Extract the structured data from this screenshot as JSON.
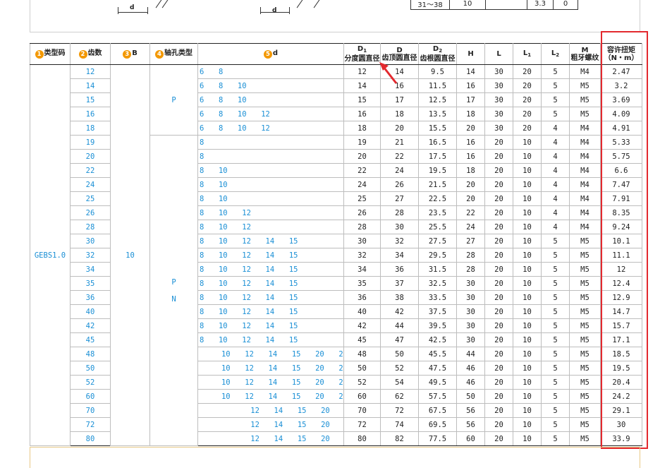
{
  "top_drawing": {
    "dim_label_1": "d",
    "dim_label_2": "d",
    "spec_row": [
      "31～38",
      "10",
      "",
      "3.3",
      "0"
    ]
  },
  "headers": {
    "type_code": {
      "num": "1",
      "label": "类型码"
    },
    "teeth": {
      "num": "2",
      "label": "齿数"
    },
    "b": {
      "num": "3",
      "label": "B"
    },
    "bore_type": {
      "num": "4",
      "label": "轴孔类型"
    },
    "d": {
      "num": "5",
      "label": "d"
    },
    "d1": {
      "sym": "D",
      "sub": "1",
      "text": "分度圆直径"
    },
    "dd": {
      "sym": "D",
      "text": "齿顶圆直径"
    },
    "d2": {
      "sym": "D",
      "sub": "2",
      "text": "齿根圆直径"
    },
    "h": "H",
    "l": "L",
    "l1": {
      "sym": "L",
      "sub": "1"
    },
    "l2": {
      "sym": "L",
      "sub": "2"
    },
    "m": {
      "sym": "M",
      "text": "粗牙螺纹"
    },
    "torque": {
      "line1": "容许扭矩",
      "line2": "（N・m）"
    }
  },
  "type_code": "GEBS1.0",
  "b_value": "10",
  "bore_p": "P",
  "bore_pn": {
    "p": "P",
    "n": "N"
  },
  "rows": [
    {
      "teeth": "12",
      "d": "6  8",
      "d1": "12",
      "dd": "14",
      "d2": "9.5",
      "h": "14",
      "l": "30",
      "l1": "20",
      "l2": "5",
      "m": "M4",
      "torque": "2.47"
    },
    {
      "teeth": "14",
      "d": "6  8  10",
      "d1": "14",
      "dd": "16",
      "d2": "11.5",
      "h": "16",
      "l": "30",
      "l1": "20",
      "l2": "5",
      "m": "M5",
      "torque": "3.2"
    },
    {
      "teeth": "15",
      "d": "6  8  10",
      "d1": "15",
      "dd": "17",
      "d2": "12.5",
      "h": "17",
      "l": "30",
      "l1": "20",
      "l2": "5",
      "m": "M5",
      "torque": "3.69"
    },
    {
      "teeth": "16",
      "d": "6  8  10  12",
      "d1": "16",
      "dd": "18",
      "d2": "13.5",
      "h": "18",
      "l": "30",
      "l1": "20",
      "l2": "5",
      "m": "M5",
      "torque": "4.09"
    },
    {
      "teeth": "18",
      "d": "6  8  10  12",
      "d1": "18",
      "dd": "20",
      "d2": "15.5",
      "h": "20",
      "l": "30",
      "l1": "20",
      "l2": "4",
      "m": "M4",
      "torque": "4.91"
    },
    {
      "teeth": "19",
      "d": "8",
      "d1": "19",
      "dd": "21",
      "d2": "16.5",
      "h": "16",
      "l": "20",
      "l1": "10",
      "l2": "4",
      "m": "M4",
      "torque": "5.33"
    },
    {
      "teeth": "20",
      "d": "8",
      "d1": "20",
      "dd": "22",
      "d2": "17.5",
      "h": "16",
      "l": "20",
      "l1": "10",
      "l2": "4",
      "m": "M4",
      "torque": "5.75"
    },
    {
      "teeth": "22",
      "d": "8  10",
      "d1": "22",
      "dd": "24",
      "d2": "19.5",
      "h": "18",
      "l": "20",
      "l1": "10",
      "l2": "4",
      "m": "M4",
      "torque": "6.6"
    },
    {
      "teeth": "24",
      "d": "8  10",
      "d1": "24",
      "dd": "26",
      "d2": "21.5",
      "h": "20",
      "l": "20",
      "l1": "10",
      "l2": "4",
      "m": "M4",
      "torque": "7.47"
    },
    {
      "teeth": "25",
      "d": "8  10",
      "d1": "25",
      "dd": "27",
      "d2": "22.5",
      "h": "20",
      "l": "20",
      "l1": "10",
      "l2": "4",
      "m": "M4",
      "torque": "7.91"
    },
    {
      "teeth": "26",
      "d": "8  10  12",
      "d1": "26",
      "dd": "28",
      "d2": "23.5",
      "h": "22",
      "l": "20",
      "l1": "10",
      "l2": "4",
      "m": "M4",
      "torque": "8.35"
    },
    {
      "teeth": "28",
      "d": "8  10  12",
      "d1": "28",
      "dd": "30",
      "d2": "25.5",
      "h": "24",
      "l": "20",
      "l1": "10",
      "l2": "4",
      "m": "M4",
      "torque": "9.24"
    },
    {
      "teeth": "30",
      "d": "8  10  12  14  15",
      "d1": "30",
      "dd": "32",
      "d2": "27.5",
      "h": "27",
      "l": "20",
      "l1": "10",
      "l2": "5",
      "m": "M5",
      "torque": "10.1"
    },
    {
      "teeth": "32",
      "d": "8  10  12  14  15",
      "d1": "32",
      "dd": "34",
      "d2": "29.5",
      "h": "28",
      "l": "20",
      "l1": "10",
      "l2": "5",
      "m": "M5",
      "torque": "11.1"
    },
    {
      "teeth": "34",
      "d": "8  10  12  14  15",
      "d1": "34",
      "dd": "36",
      "d2": "31.5",
      "h": "28",
      "l": "20",
      "l1": "10",
      "l2": "5",
      "m": "M5",
      "torque": "12"
    },
    {
      "teeth": "35",
      "d": "8  10  12  14  15",
      "d1": "35",
      "dd": "37",
      "d2": "32.5",
      "h": "30",
      "l": "20",
      "l1": "10",
      "l2": "5",
      "m": "M5",
      "torque": "12.4"
    },
    {
      "teeth": "36",
      "d": "8  10  12  14  15",
      "d1": "36",
      "dd": "38",
      "d2": "33.5",
      "h": "30",
      "l": "20",
      "l1": "10",
      "l2": "5",
      "m": "M5",
      "torque": "12.9"
    },
    {
      "teeth": "40",
      "d": "8  10  12  14  15",
      "d1": "40",
      "dd": "42",
      "d2": "37.5",
      "h": "30",
      "l": "20",
      "l1": "10",
      "l2": "5",
      "m": "M5",
      "torque": "14.7"
    },
    {
      "teeth": "42",
      "d": "8  10  12  14  15",
      "d1": "42",
      "dd": "44",
      "d2": "39.5",
      "h": "30",
      "l": "20",
      "l1": "10",
      "l2": "5",
      "m": "M5",
      "torque": "15.7"
    },
    {
      "teeth": "45",
      "d": "8  10  12  14  15",
      "d1": "45",
      "dd": "47",
      "d2": "42.5",
      "h": "30",
      "l": "20",
      "l1": "10",
      "l2": "5",
      "m": "M5",
      "torque": "17.1"
    },
    {
      "teeth": "48",
      "d": "   10  12  14  15  20  25",
      "d1": "48",
      "dd": "50",
      "d2": "45.5",
      "h": "44",
      "l": "20",
      "l1": "10",
      "l2": "5",
      "m": "M5",
      "torque": "18.5"
    },
    {
      "teeth": "50",
      "d": "   10  12  14  15  20  25",
      "d1": "50",
      "dd": "52",
      "d2": "47.5",
      "h": "46",
      "l": "20",
      "l1": "10",
      "l2": "5",
      "m": "M5",
      "torque": "19.5"
    },
    {
      "teeth": "52",
      "d": "   10  12  14  15  20  25",
      "d1": "52",
      "dd": "54",
      "d2": "49.5",
      "h": "46",
      "l": "20",
      "l1": "10",
      "l2": "5",
      "m": "M5",
      "torque": "20.4"
    },
    {
      "teeth": "60",
      "d": "   10  12  14  15  20  25  30",
      "d1": "60",
      "dd": "62",
      "d2": "57.5",
      "h": "50",
      "l": "20",
      "l1": "10",
      "l2": "5",
      "m": "M5",
      "torque": "24.2"
    },
    {
      "teeth": "70",
      "d": "       12  14  15  20  25  30  35",
      "d1": "70",
      "dd": "72",
      "d2": "67.5",
      "h": "56",
      "l": "20",
      "l1": "10",
      "l2": "5",
      "m": "M5",
      "torque": "29.1"
    },
    {
      "teeth": "72",
      "d": "       12  14  15  20  25  30  35",
      "d1": "72",
      "dd": "74",
      "d2": "69.5",
      "h": "56",
      "l": "20",
      "l1": "10",
      "l2": "5",
      "m": "M5",
      "torque": "30"
    },
    {
      "teeth": "80",
      "d": "       12  14  15  20  25  30  35",
      "d1": "80",
      "dd": "82",
      "d2": "77.5",
      "h": "60",
      "l": "20",
      "l1": "10",
      "l2": "5",
      "m": "M5",
      "torque": "33.9"
    }
  ],
  "colors": {
    "accent_orange": "#f39800",
    "value_blue": "#1a8fd5",
    "highlight_red": "#e3292e",
    "panel_border": "#e8c886"
  }
}
